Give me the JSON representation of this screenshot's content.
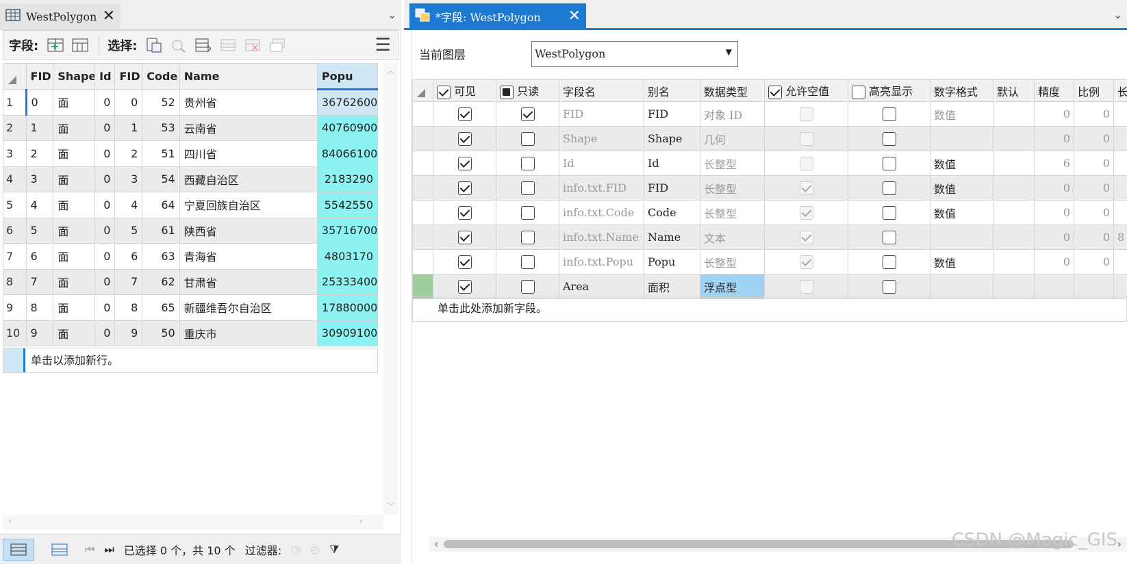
{
  "left": {
    "tab_title": "WestPolygon",
    "toolbar": {
      "fields_label": "字段:",
      "select_label": "选择:"
    },
    "columns": [
      "FID",
      "Shape",
      "Id",
      "FID",
      "Code",
      "Name",
      "Popu"
    ],
    "rows": [
      {
        "n": "1",
        "fid": "0",
        "shape": "面",
        "id": "0",
        "fid2": "0",
        "code": "52",
        "name": "贵州省",
        "popu": "36762600"
      },
      {
        "n": "2",
        "fid": "1",
        "shape": "面",
        "id": "0",
        "fid2": "1",
        "code": "53",
        "name": "云南省",
        "popu": "40760900"
      },
      {
        "n": "3",
        "fid": "2",
        "shape": "面",
        "id": "0",
        "fid2": "2",
        "code": "51",
        "name": "四川省",
        "popu": "84066100"
      },
      {
        "n": "4",
        "fid": "3",
        "shape": "面",
        "id": "0",
        "fid2": "3",
        "code": "54",
        "name": "西藏自治区",
        "popu": "2183290"
      },
      {
        "n": "5",
        "fid": "4",
        "shape": "面",
        "id": "0",
        "fid2": "4",
        "code": "64",
        "name": "宁夏回族自治区",
        "popu": "5542550"
      },
      {
        "n": "6",
        "fid": "5",
        "shape": "面",
        "id": "0",
        "fid2": "5",
        "code": "61",
        "name": "陕西省",
        "popu": "35716700"
      },
      {
        "n": "7",
        "fid": "6",
        "shape": "面",
        "id": "0",
        "fid2": "6",
        "code": "63",
        "name": "青海省",
        "popu": "4803170"
      },
      {
        "n": "8",
        "fid": "7",
        "shape": "面",
        "id": "0",
        "fid2": "7",
        "code": "62",
        "name": "甘肃省",
        "popu": "25333400"
      },
      {
        "n": "9",
        "fid": "8",
        "shape": "面",
        "id": "0",
        "fid2": "8",
        "code": "65",
        "name": "新疆维吾尔自治区",
        "popu": "17880000"
      },
      {
        "n": "10",
        "fid": "9",
        "shape": "面",
        "id": "0",
        "fid2": "9",
        "code": "50",
        "name": "重庆市",
        "popu": "30909100"
      }
    ],
    "add_row_text": "单击以添加新行。",
    "status": {
      "selection": "已选择 0 个，共 10 个",
      "filter_label": "过滤器:"
    }
  },
  "right": {
    "tab_title": "*字段:  WestPolygon",
    "layer_label": "当前图层",
    "layer_value": "WestPolygon",
    "headers": [
      "可见",
      "只读",
      "字段名",
      "别名",
      "数据类型",
      "允许空值",
      "高亮显示",
      "数字格式",
      "默认",
      "精度",
      "比例",
      "长"
    ],
    "rows": [
      {
        "visible": true,
        "readonly": true,
        "name": "FID",
        "alias": "FID",
        "type": "对象 ID",
        "nullable": false,
        "highlight": false,
        "format": "数值",
        "default": "",
        "precision": "0",
        "scale": "0",
        "length": ""
      },
      {
        "visible": true,
        "readonly": false,
        "name": "Shape",
        "alias": "Shape",
        "type": "几何",
        "nullable": false,
        "highlight": false,
        "format": "",
        "default": "",
        "precision": "0",
        "scale": "0",
        "length": ""
      },
      {
        "visible": true,
        "readonly": false,
        "name": "Id",
        "alias": "Id",
        "type": "长整型",
        "nullable": false,
        "highlight": false,
        "format": "数值",
        "default": "",
        "precision": "6",
        "scale": "0",
        "length": ""
      },
      {
        "visible": true,
        "readonly": false,
        "name": "info.txt.FID",
        "alias": "FID",
        "type": "长整型",
        "nullable": true,
        "highlight": false,
        "format": "数值",
        "default": "",
        "precision": "0",
        "scale": "0",
        "length": ""
      },
      {
        "visible": true,
        "readonly": false,
        "name": "info.txt.Code",
        "alias": "Code",
        "type": "长整型",
        "nullable": true,
        "highlight": false,
        "format": "数值",
        "default": "",
        "precision": "0",
        "scale": "0",
        "length": ""
      },
      {
        "visible": true,
        "readonly": false,
        "name": "info.txt.Name",
        "alias": "Name",
        "type": "文本",
        "nullable": true,
        "highlight": false,
        "format": "",
        "default": "",
        "precision": "0",
        "scale": "0",
        "length": "8"
      },
      {
        "visible": true,
        "readonly": false,
        "name": "info.txt.Popu",
        "alias": "Popu",
        "type": "长整型",
        "nullable": true,
        "highlight": false,
        "format": "数值",
        "default": "",
        "precision": "0",
        "scale": "0",
        "length": ""
      },
      {
        "visible": true,
        "readonly": false,
        "name": "Area",
        "alias": "面积",
        "type": "浮点型",
        "nullable": false,
        "highlight": false,
        "format": "",
        "default": "",
        "precision": "",
        "scale": "",
        "length": ""
      }
    ],
    "add_field_text": "单击此处添加新字段。"
  },
  "watermark": "CSDN @Magic_GIS",
  "colors": {
    "accent": "#1d7ad3",
    "popu_fill": "#8df2f2",
    "new_row": "#9ccf9c"
  }
}
